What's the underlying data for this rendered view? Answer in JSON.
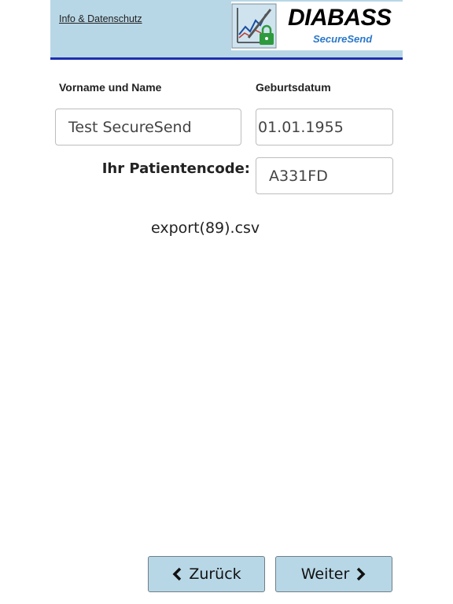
{
  "header": {
    "info_link": "Info & Datenschutz",
    "logo_title": "DIABASS",
    "logo_subtitle": "SecureSend"
  },
  "form": {
    "name_label": "Vorname und Name",
    "name_value": "Test SecureSend",
    "birth_label": "Geburtsdatum",
    "birth_value": "01.01.1955",
    "patient_code_label": "Ihr Patientencode:",
    "patient_code_value": "A331FD"
  },
  "file": {
    "name": "export(89).csv"
  },
  "buttons": {
    "back_label": "Zurück",
    "next_label": "Weiter"
  },
  "colors": {
    "header_bg": "#b8d7e6",
    "header_border": "#1d2fb0",
    "button_bg": "#b8d7e6",
    "subtitle_blue": "#2a78c8"
  }
}
